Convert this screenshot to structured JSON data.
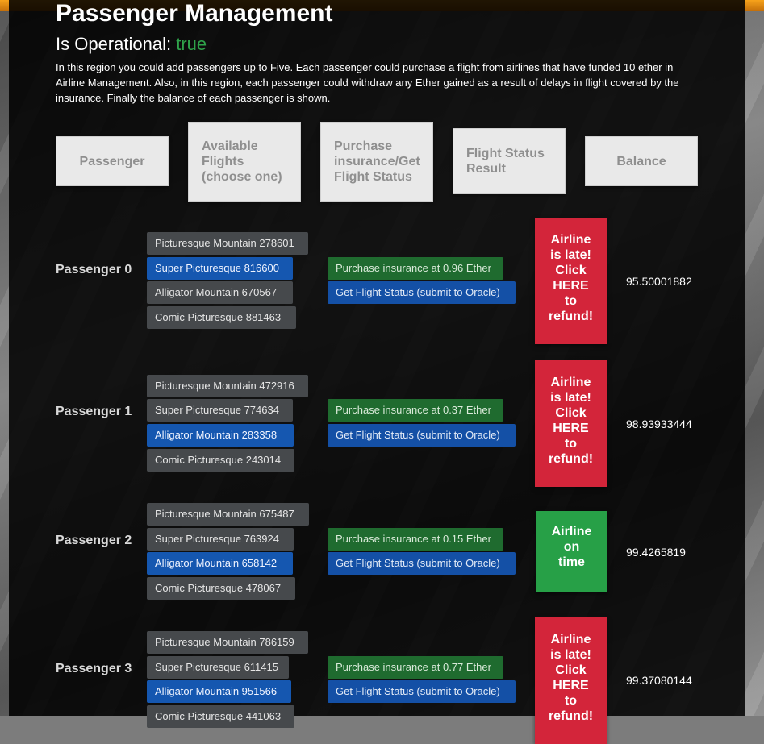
{
  "page": {
    "title": "Passenger Management",
    "operational_label": "Is Operational:",
    "operational_value": "true",
    "description": "In this region you could add passengers up to Five. Each passenger could purchase a flight from airlines that have funded 10 ether in Airline Management. Also, in this region, each passenger could withdraw any Ether gained as a result of delays in flight covered by the insurance. Finally the balance of each passenger is shown."
  },
  "headers": [
    "Passenger",
    "Available Flights (choose one)",
    "Purchase insurance/Get Flight Status",
    "Flight Status Result",
    "Balance"
  ],
  "passengers": [
    {
      "label": "Passenger 0",
      "flights": [
        "Picturesque Mountain 278601",
        "Super Picturesque 816600",
        "Alligator Mountain 670567",
        "Comic Picturesque 881463"
      ],
      "selected": 1,
      "buy_label": "Purchase insurance at 0.96 Ether",
      "status_label": "Get Flight Status (submit to Oracle)",
      "result_lines": [
        "Airline",
        "is late!",
        "Click",
        "HERE",
        "to",
        "refund!"
      ],
      "result_state": "late",
      "balance": "95.50001882"
    },
    {
      "label": "Passenger 1",
      "flights": [
        "Picturesque Mountain 472916",
        "Super Picturesque 774634",
        "Alligator Mountain 283358",
        "Comic Picturesque 243014"
      ],
      "selected": 2,
      "buy_label": "Purchase insurance at 0.37 Ether",
      "status_label": "Get Flight Status (submit to Oracle)",
      "result_lines": [
        "Airline",
        "is late!",
        "Click",
        "HERE",
        "to",
        "refund!"
      ],
      "result_state": "late",
      "balance": "98.93933444"
    },
    {
      "label": "Passenger 2",
      "flights": [
        "Picturesque Mountain 675487",
        "Super Picturesque 763924",
        "Alligator Mountain 658142",
        "Comic Picturesque 478067"
      ],
      "selected": 2,
      "buy_label": "Purchase insurance at 0.15 Ether",
      "status_label": "Get Flight Status (submit to Oracle)",
      "result_lines": [
        "Airline",
        "on",
        "time"
      ],
      "result_state": "ok",
      "balance": "99.4265819"
    },
    {
      "label": "Passenger 3",
      "flights": [
        "Picturesque Mountain 786159",
        "Super Picturesque 611415",
        "Alligator Mountain 951566",
        "Comic Picturesque 441063"
      ],
      "selected": 2,
      "buy_label": "Purchase insurance at 0.77 Ether",
      "status_label": "Get Flight Status (submit to Oracle)",
      "result_lines": [
        "Airline",
        "is late!",
        "Click",
        "HERE",
        "to",
        "refund!"
      ],
      "result_state": "late",
      "balance": "99.37080144"
    }
  ]
}
